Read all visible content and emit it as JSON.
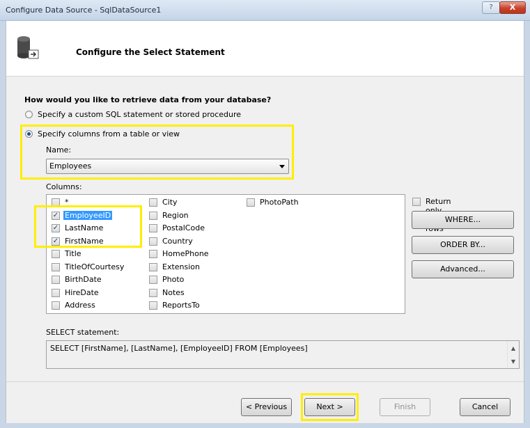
{
  "window": {
    "title": "Configure Data Source - SqlDataSource1",
    "help_label": "?",
    "close_label": "X"
  },
  "header": {
    "title": "Configure the Select Statement",
    "icon": "database-icon"
  },
  "question": "How would you like to retrieve data from your database?",
  "options": {
    "custom_sql": "Specify a custom SQL statement or stored procedure",
    "table_columns": "Specify columns from a table or view"
  },
  "name_label": "Name:",
  "name_value": "Employees",
  "columns_label": "Columns:",
  "columns": [
    {
      "label": "*",
      "checked": false
    },
    {
      "label": "EmployeeID",
      "checked": true
    },
    {
      "label": "LastName",
      "checked": true
    },
    {
      "label": "FirstName",
      "checked": true
    },
    {
      "label": "Title",
      "checked": false
    },
    {
      "label": "TitleOfCourtesy",
      "checked": false
    },
    {
      "label": "BirthDate",
      "checked": false
    },
    {
      "label": "HireDate",
      "checked": false
    },
    {
      "label": "Address",
      "checked": false
    },
    {
      "label": "City",
      "checked": false
    },
    {
      "label": "Region",
      "checked": false
    },
    {
      "label": "PostalCode",
      "checked": false
    },
    {
      "label": "Country",
      "checked": false
    },
    {
      "label": "HomePhone",
      "checked": false
    },
    {
      "label": "Extension",
      "checked": false
    },
    {
      "label": "Photo",
      "checked": false
    },
    {
      "label": "Notes",
      "checked": false
    },
    {
      "label": "ReportsTo",
      "checked": false
    },
    {
      "label": "PhotoPath",
      "checked": false
    }
  ],
  "unique_rows_label": "Return only unique rows",
  "side_buttons": {
    "where": "WHERE...",
    "order_by": "ORDER BY...",
    "advanced": "Advanced..."
  },
  "sql": {
    "label": "SELECT statement:",
    "text": "SELECT [FirstName], [LastName], [EmployeeID] FROM [Employees]"
  },
  "footer": {
    "previous": "< Previous",
    "next": "Next >",
    "finish": "Finish",
    "cancel": "Cancel"
  },
  "colors": {
    "highlight": "#ffee00",
    "selection": "#3399ff"
  }
}
